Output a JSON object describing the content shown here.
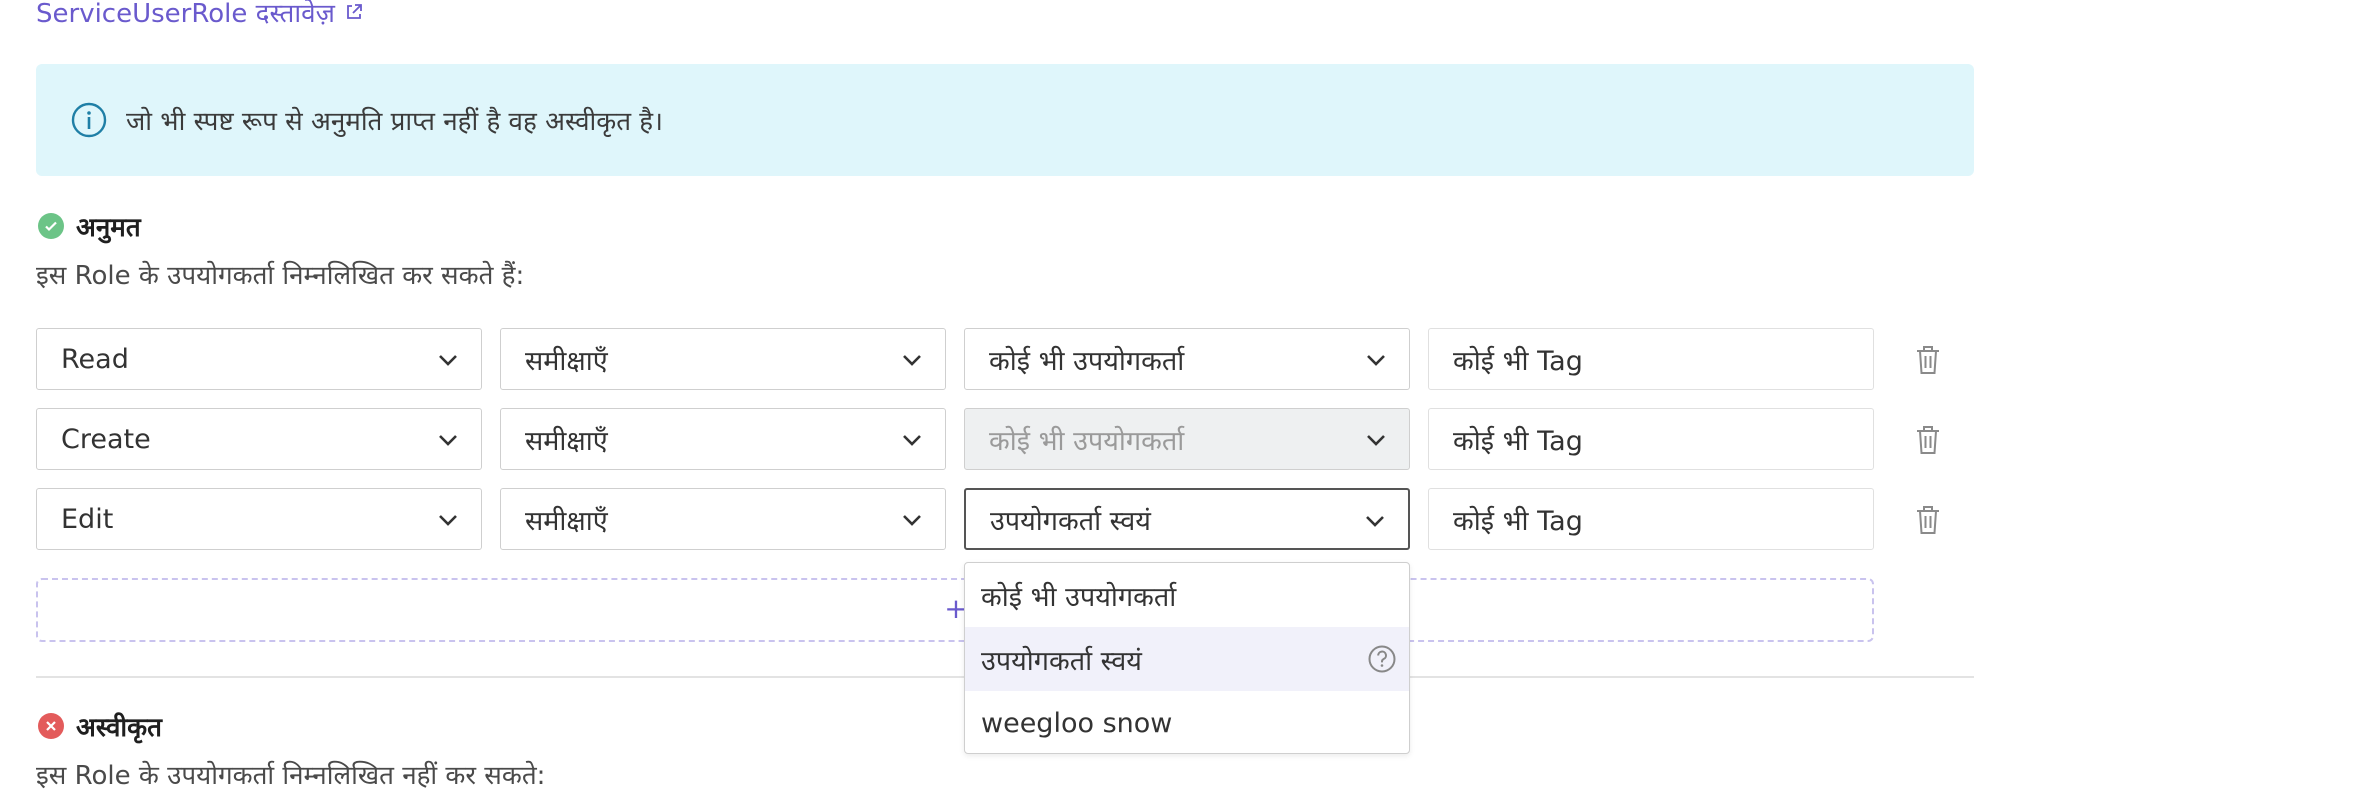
{
  "header": {
    "doc_link_label": "ServiceUserRole दस्तावेज़"
  },
  "info": {
    "text": "जो भी स्पष्ट रूप से अनुमति प्राप्त नहीं है वह अस्वीकृत है।"
  },
  "allowed": {
    "title": "अनुमत",
    "description": "इस Role के उपयोगकर्ता निम्नलिखित कर सकते हैं:",
    "rules": [
      {
        "action": "Read",
        "resource": "समीक्षाएँ",
        "user": "कोई भी उपयोगकर्ता",
        "tag": "कोई भी Tag"
      },
      {
        "action": "Create",
        "resource": "समीक्षाएँ",
        "user": "कोई भी उपयोगकर्ता",
        "tag": "कोई भी Tag"
      },
      {
        "action": "Edit",
        "resource": "समीक्षाएँ",
        "user": "उपयोगकर्ता स्वयं",
        "tag": "कोई भी Tag"
      }
    ]
  },
  "dropdown": {
    "options": [
      "कोई भी उपयोगकर्ता",
      "उपयोगकर्ता स्वयं",
      "weegloo snow"
    ],
    "highlighted": "उपयोगकर्ता स्वयं"
  },
  "denied": {
    "title": "अस्वीकृत",
    "description": "इस Role के उपयोगकर्ता निम्नलिखित नहीं कर सकते:"
  },
  "colors": {
    "accent": "#6a5acd",
    "info_bg": "#dff6fb",
    "allowed": "#6cc487",
    "denied": "#e35b5b"
  },
  "icons": {
    "external": "external-link-icon",
    "info": "info-icon",
    "check": "check-icon",
    "cross": "x-icon",
    "chevron": "chevron-down-icon",
    "trash": "trash-icon",
    "plus": "plus-icon",
    "help": "question-mark-icon"
  }
}
